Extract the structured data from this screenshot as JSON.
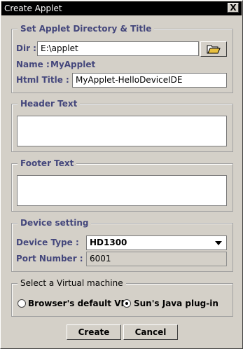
{
  "window": {
    "title": "Create Applet",
    "close_glyph": "X"
  },
  "directory": {
    "legend": "Set Applet Directory & Title",
    "dir_label": "Dir :",
    "dir_value": "E:\\applet",
    "browse_icon": "folder-open-icon",
    "name_label": "Name :",
    "name_value": "MyApplet",
    "html_title_label": "Html Title :",
    "html_title_value": "MyApplet-HelloDeviceIDE"
  },
  "header": {
    "legend": "Header Text",
    "value": ""
  },
  "footer": {
    "legend": "Footer Text",
    "value": ""
  },
  "device": {
    "legend": "Device setting",
    "type_label": "Device Type :",
    "type_value": "HD1300",
    "port_label": "Port Number :",
    "port_value": "6001"
  },
  "vm": {
    "legend": "Select a Virtual machine",
    "options": [
      {
        "label": "Browser's default VM",
        "selected": false
      },
      {
        "label": "Sun's Java plug-in",
        "selected": true
      }
    ]
  },
  "buttons": {
    "create": "Create",
    "cancel": "Cancel"
  }
}
